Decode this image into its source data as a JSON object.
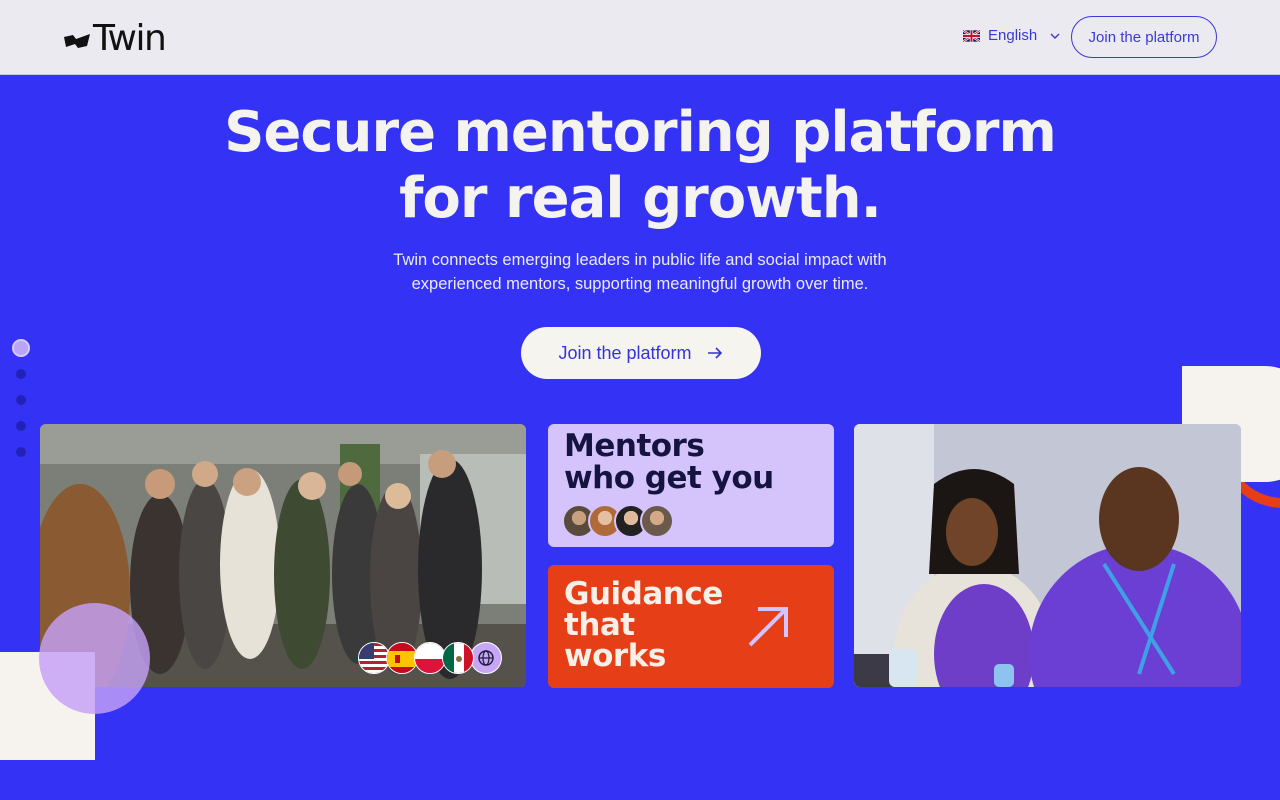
{
  "header": {
    "logo_text": "Twin",
    "language_label": "English",
    "language_flag": "uk-flag-icon",
    "join_button_label": "Join the platform"
  },
  "hero": {
    "title_line1": "Secure mentoring platform",
    "title_line2": "for real growth.",
    "subtitle_line1": "Twin connects emerging leaders in public life and social impact with",
    "subtitle_line2": "experienced mentors, supporting meaningful growth over time.",
    "cta_label": "Join the platform"
  },
  "cards": {
    "mentors_line1": "Mentors",
    "mentors_line2": "who get you",
    "guidance_line1": "Guidance",
    "guidance_line2": "that",
    "guidance_line3": "works"
  },
  "carousel": {
    "slide_count": 5,
    "active_index": 0
  },
  "flags": [
    "us-flag-icon",
    "spain-flag-icon",
    "poland-flag-icon",
    "mexico-flag-icon",
    "globe-icon"
  ],
  "colors": {
    "brand_blue": "#3332f5",
    "lavender": "#d5c3fb",
    "orange": "#e63e17",
    "cream": "#f6f3ee"
  }
}
